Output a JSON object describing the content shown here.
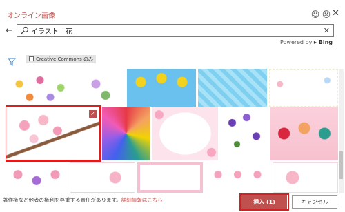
{
  "titlebar": {
    "title": "オンライン画像"
  },
  "search": {
    "value": "イラスト　花"
  },
  "powered_by": {
    "prefix": "Powered by",
    "brand": "Bing"
  },
  "filter": {
    "cc_label": "Creative Commons のみ"
  },
  "footer": {
    "notice": "著作権など他者の権利を尊重する責任があります。",
    "link": "詳細情報はこちら"
  },
  "buttons": {
    "insert_label": "挿入 (1)",
    "cancel_label": "キャンセル"
  },
  "colors": {
    "accent": "#c0504d",
    "selection": "#d81e1e"
  },
  "icons": [
    "smile-icon",
    "frown-icon",
    "close-icon",
    "back-arrow-icon",
    "search-icon",
    "clear-icon",
    "filter-icon"
  ]
}
